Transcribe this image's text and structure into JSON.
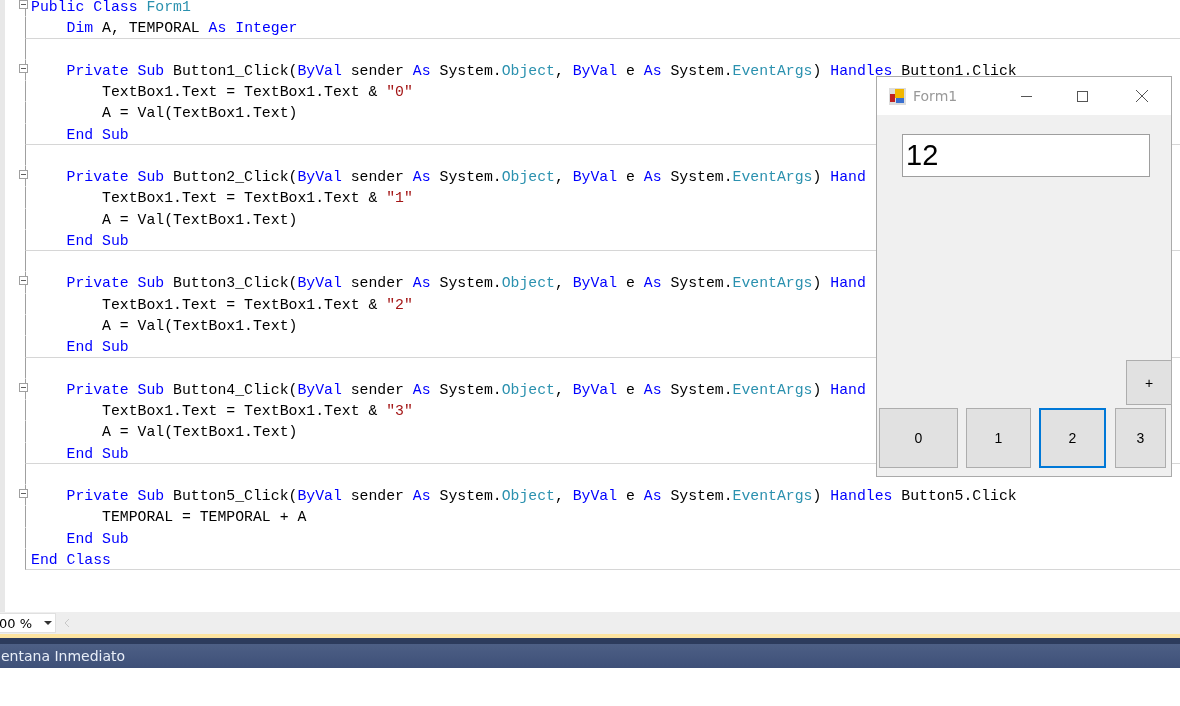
{
  "editor": {
    "lines": [
      {
        "foldable": true,
        "separator": false,
        "tokens": [
          {
            "kind": "keyword",
            "text": "Public Class "
          },
          {
            "kind": "type",
            "text": "Form1"
          }
        ]
      },
      {
        "foldable": false,
        "separator": true,
        "tokens": [
          {
            "kind": "keyword",
            "text": "    Dim "
          },
          {
            "kind": "plain",
            "text": "A, TEMPORAL "
          },
          {
            "kind": "keyword",
            "text": "As Integer"
          }
        ]
      },
      {
        "foldable": false,
        "separator": false
      },
      {
        "foldable": true,
        "separator": false,
        "tokens": [
          {
            "kind": "keyword",
            "text": "    Private Sub "
          },
          {
            "kind": "plain",
            "text": "Button1_Click("
          },
          {
            "kind": "keyword",
            "text": "ByVal "
          },
          {
            "kind": "plain",
            "text": "sender "
          },
          {
            "kind": "keyword",
            "text": "As "
          },
          {
            "kind": "plain",
            "text": "System."
          },
          {
            "kind": "type",
            "text": "Object"
          },
          {
            "kind": "plain",
            "text": ", "
          },
          {
            "kind": "keyword",
            "text": "ByVal "
          },
          {
            "kind": "plain",
            "text": "e "
          },
          {
            "kind": "keyword",
            "text": "As "
          },
          {
            "kind": "plain",
            "text": "System."
          },
          {
            "kind": "type",
            "text": "EventArgs"
          },
          {
            "kind": "plain",
            "text": ") "
          },
          {
            "kind": "keyword",
            "text": "Handles "
          },
          {
            "kind": "plain",
            "text": "Button1.Click"
          }
        ]
      },
      {
        "foldable": false,
        "separator": false,
        "tokens": [
          {
            "kind": "plain",
            "text": "        TextBox1.Text = TextBox1.Text & "
          },
          {
            "kind": "string",
            "text": "\"0\""
          }
        ]
      },
      {
        "foldable": false,
        "separator": false,
        "tokens": [
          {
            "kind": "plain",
            "text": "        A = Val(TextBox1.Text)"
          }
        ]
      },
      {
        "foldable": false,
        "separator": true,
        "tokens": [
          {
            "kind": "keyword",
            "text": "    End Sub"
          }
        ]
      },
      {
        "foldable": false,
        "separator": false
      },
      {
        "foldable": true,
        "separator": false,
        "tokens": [
          {
            "kind": "keyword",
            "text": "    Private Sub "
          },
          {
            "kind": "plain",
            "text": "Button2_Click("
          },
          {
            "kind": "keyword",
            "text": "ByVal "
          },
          {
            "kind": "plain",
            "text": "sender "
          },
          {
            "kind": "keyword",
            "text": "As "
          },
          {
            "kind": "plain",
            "text": "System."
          },
          {
            "kind": "type",
            "text": "Object"
          },
          {
            "kind": "plain",
            "text": ", "
          },
          {
            "kind": "keyword",
            "text": "ByVal "
          },
          {
            "kind": "plain",
            "text": "e "
          },
          {
            "kind": "keyword",
            "text": "As "
          },
          {
            "kind": "plain",
            "text": "System."
          },
          {
            "kind": "type",
            "text": "EventArgs"
          },
          {
            "kind": "plain",
            "text": ") "
          },
          {
            "kind": "keyword",
            "text": "Hand"
          }
        ]
      },
      {
        "foldable": false,
        "separator": false,
        "tokens": [
          {
            "kind": "plain",
            "text": "        TextBox1.Text = TextBox1.Text & "
          },
          {
            "kind": "string",
            "text": "\"1\""
          }
        ]
      },
      {
        "foldable": false,
        "separator": false,
        "tokens": [
          {
            "kind": "plain",
            "text": "        A = Val(TextBox1.Text)"
          }
        ]
      },
      {
        "foldable": false,
        "separator": true,
        "tokens": [
          {
            "kind": "keyword",
            "text": "    End Sub"
          }
        ]
      },
      {
        "foldable": false,
        "separator": false
      },
      {
        "foldable": true,
        "separator": false,
        "tokens": [
          {
            "kind": "keyword",
            "text": "    Private Sub "
          },
          {
            "kind": "plain",
            "text": "Button3_Click("
          },
          {
            "kind": "keyword",
            "text": "ByVal "
          },
          {
            "kind": "plain",
            "text": "sender "
          },
          {
            "kind": "keyword",
            "text": "As "
          },
          {
            "kind": "plain",
            "text": "System."
          },
          {
            "kind": "type",
            "text": "Object"
          },
          {
            "kind": "plain",
            "text": ", "
          },
          {
            "kind": "keyword",
            "text": "ByVal "
          },
          {
            "kind": "plain",
            "text": "e "
          },
          {
            "kind": "keyword",
            "text": "As "
          },
          {
            "kind": "plain",
            "text": "System."
          },
          {
            "kind": "type",
            "text": "EventArgs"
          },
          {
            "kind": "plain",
            "text": ") "
          },
          {
            "kind": "keyword",
            "text": "Hand"
          }
        ]
      },
      {
        "foldable": false,
        "separator": false,
        "tokens": [
          {
            "kind": "plain",
            "text": "        TextBox1.Text = TextBox1.Text & "
          },
          {
            "kind": "string",
            "text": "\"2\""
          }
        ]
      },
      {
        "foldable": false,
        "separator": false,
        "tokens": [
          {
            "kind": "plain",
            "text": "        A = Val(TextBox1.Text)"
          }
        ]
      },
      {
        "foldable": false,
        "separator": true,
        "tokens": [
          {
            "kind": "keyword",
            "text": "    End Sub"
          }
        ]
      },
      {
        "foldable": false,
        "separator": false
      },
      {
        "foldable": true,
        "separator": false,
        "tokens": [
          {
            "kind": "keyword",
            "text": "    Private Sub "
          },
          {
            "kind": "plain",
            "text": "Button4_Click("
          },
          {
            "kind": "keyword",
            "text": "ByVal "
          },
          {
            "kind": "plain",
            "text": "sender "
          },
          {
            "kind": "keyword",
            "text": "As "
          },
          {
            "kind": "plain",
            "text": "System."
          },
          {
            "kind": "type",
            "text": "Object"
          },
          {
            "kind": "plain",
            "text": ", "
          },
          {
            "kind": "keyword",
            "text": "ByVal "
          },
          {
            "kind": "plain",
            "text": "e "
          },
          {
            "kind": "keyword",
            "text": "As "
          },
          {
            "kind": "plain",
            "text": "System."
          },
          {
            "kind": "type",
            "text": "EventArgs"
          },
          {
            "kind": "plain",
            "text": ") "
          },
          {
            "kind": "keyword",
            "text": "Hand"
          }
        ]
      },
      {
        "foldable": false,
        "separator": false,
        "tokens": [
          {
            "kind": "plain",
            "text": "        TextBox1.Text = TextBox1.Text & "
          },
          {
            "kind": "string",
            "text": "\"3\""
          }
        ]
      },
      {
        "foldable": false,
        "separator": false,
        "tokens": [
          {
            "kind": "plain",
            "text": "        A = Val(TextBox1.Text)"
          }
        ]
      },
      {
        "foldable": false,
        "separator": true,
        "tokens": [
          {
            "kind": "keyword",
            "text": "    End Sub"
          }
        ]
      },
      {
        "foldable": false,
        "separator": false
      },
      {
        "foldable": true,
        "separator": false,
        "tokens": [
          {
            "kind": "keyword",
            "text": "    Private Sub "
          },
          {
            "kind": "plain",
            "text": "Button5_Click("
          },
          {
            "kind": "keyword",
            "text": "ByVal "
          },
          {
            "kind": "plain",
            "text": "sender "
          },
          {
            "kind": "keyword",
            "text": "As "
          },
          {
            "kind": "plain",
            "text": "System."
          },
          {
            "kind": "type",
            "text": "Object"
          },
          {
            "kind": "plain",
            "text": ", "
          },
          {
            "kind": "keyword",
            "text": "ByVal "
          },
          {
            "kind": "plain",
            "text": "e "
          },
          {
            "kind": "keyword",
            "text": "As "
          },
          {
            "kind": "plain",
            "text": "System."
          },
          {
            "kind": "type",
            "text": "EventArgs"
          },
          {
            "kind": "plain",
            "text": ") "
          },
          {
            "kind": "keyword",
            "text": "Handles "
          },
          {
            "kind": "plain",
            "text": "Button5.Click"
          }
        ]
      },
      {
        "foldable": false,
        "separator": false,
        "tokens": [
          {
            "kind": "plain",
            "text": "        TEMPORAL = TEMPORAL + A"
          }
        ]
      },
      {
        "foldable": false,
        "separator": false,
        "tokens": [
          {
            "kind": "keyword",
            "text": "    End Sub"
          }
        ]
      },
      {
        "foldable": false,
        "separator": true,
        "tokens": [
          {
            "kind": "keyword",
            "text": "End Class"
          }
        ]
      }
    ]
  },
  "zoom": {
    "value": "00 %"
  },
  "immediate_tab": {
    "label": "entana Inmediato"
  },
  "form_window": {
    "title": "Form1",
    "textbox": {
      "value": "12"
    },
    "buttons": [
      {
        "label": "+",
        "focused": false
      },
      {
        "label": "0",
        "focused": false
      },
      {
        "label": "1",
        "focused": false
      },
      {
        "label": "2",
        "focused": true
      },
      {
        "label": "3",
        "focused": false
      }
    ]
  }
}
